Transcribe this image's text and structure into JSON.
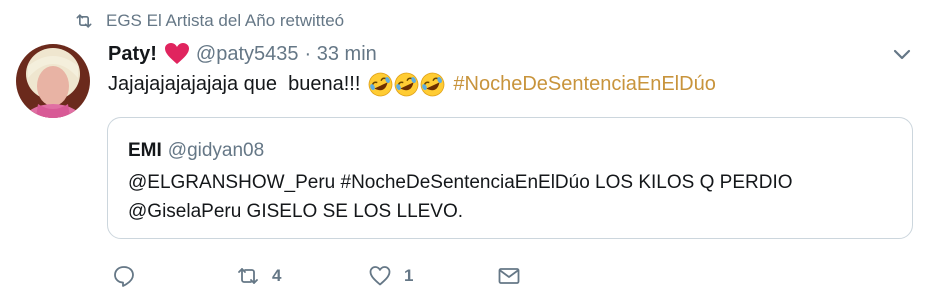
{
  "retweet_context": {
    "icon": "retweet-icon",
    "text": "EGS El Artista del Año retwitteó"
  },
  "tweet": {
    "author_name": "Paty!",
    "handle": "@paty5435",
    "time": "· 33 min",
    "text": "Jajajajajajajaja que  buena!!!",
    "emojis": [
      "rolling-on-floor-laughing",
      "rolling-on-floor-laughing",
      "rolling-on-floor-laughing"
    ],
    "hashtag": "#NocheDeSentenciaEnElDúo"
  },
  "quoted_tweet": {
    "author_name": "EMI",
    "handle": "@gidyan08",
    "line1": "@ELGRANSHOW_Peru #NocheDeSentenciaEnElDúo LOS KILOS Q PERDIO",
    "line2": "@GiselaPeru GISELO SE LOS LLEVO."
  },
  "actions": {
    "retweet_count": "4",
    "like_count": "1"
  },
  "colors": {
    "muted": "#657786",
    "hashtag": "#c8943c",
    "heart": "#e0245e",
    "border": "#ccd6dd"
  }
}
